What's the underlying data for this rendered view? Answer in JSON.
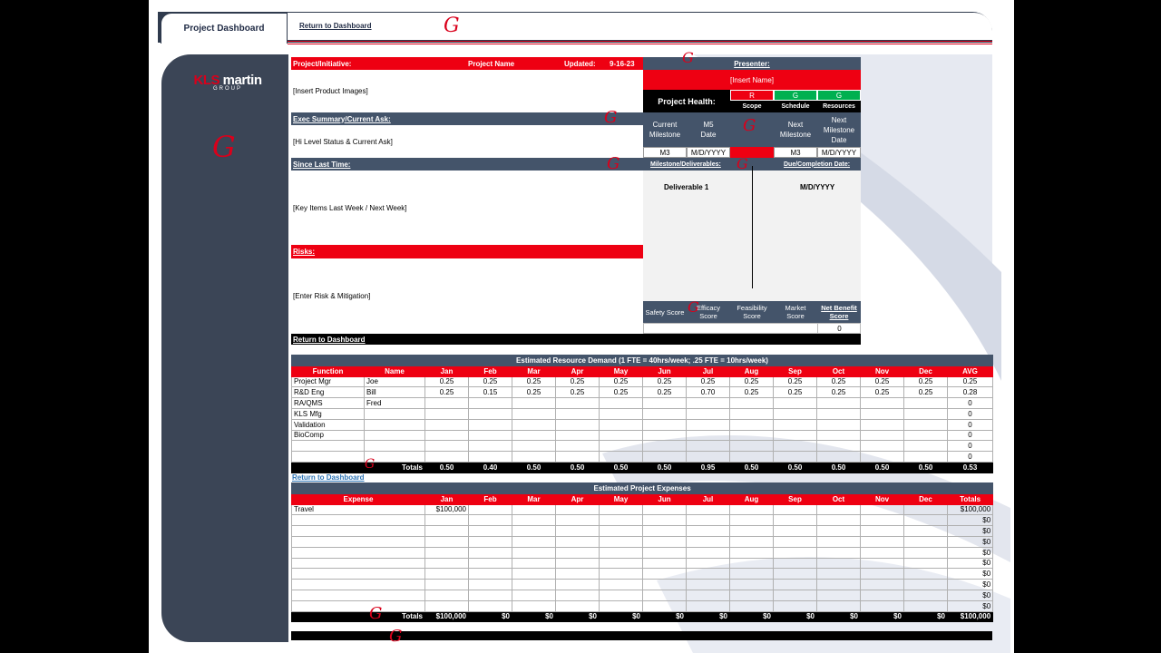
{
  "header": {
    "active_tab": "Project Dashboard",
    "return_link": "Return to Dashboard"
  },
  "logo": {
    "brand_a": "KLS",
    "brand_b": "martin",
    "group": "GROUP"
  },
  "project": {
    "label": "Project/Initiative:",
    "name": "Project Name",
    "updated_label": "Updated:",
    "updated_value": "9-16-23",
    "images_placeholder": "[Insert Product Images]",
    "exec_label": "Exec Summary/Current Ask:",
    "exec_value": "[Hi Level Status & Current Ask]",
    "since_label": "Since Last Time:",
    "since_value": "[Key Items Last Week / Next Week]",
    "risks_label": "Risks:",
    "risks_value": "[Enter Risk & Mitigation]",
    "return_link": "Return to Dashboard"
  },
  "presenter": {
    "label": "Presenter:",
    "name_placeholder": "[Insert Name]",
    "health_label": "Project Health:",
    "health": [
      {
        "value": "R",
        "label": "Scope",
        "color": "#ee0012"
      },
      {
        "value": "G",
        "label": "Schedule",
        "color": "#00b050"
      },
      {
        "value": "G",
        "label": "Resources",
        "color": "#00b050"
      }
    ],
    "milestones": {
      "current_label": "Current Milestone",
      "date_label": "M5 Date",
      "next_label": "Next Milestone",
      "next_date_label": "Next Milestone Date",
      "current_value": "M3",
      "current_date": "M/D/YYYY",
      "next_value": "M3",
      "next_date": "M/D/YYYY"
    },
    "deliverables_label": "Milestone/Deliverables:",
    "due_label": "Due/Completion Date:",
    "deliverable": "Deliverable 1",
    "deliverable_date": "M/D/YYYY",
    "scores": {
      "safety": "Safety Score",
      "efficacy": "Efficacy Score",
      "feasibility": "Feasibility Score",
      "market": "Market Score",
      "net_benefit": "Net Benefit Score",
      "net_benefit_value": "0"
    }
  },
  "resource_demand": {
    "title": "Estimated Resource Demand (1 FTE = 40hrs/week; .25 FTE = 10hrs/week)",
    "headers": [
      "Function",
      "Name",
      "Jan",
      "Feb",
      "Mar",
      "Apr",
      "May",
      "Jun",
      "Jul",
      "Aug",
      "Sep",
      "Oct",
      "Nov",
      "Dec",
      "AVG"
    ],
    "rows": [
      [
        "Project Mgr",
        "Joe",
        "0.25",
        "0.25",
        "0.25",
        "0.25",
        "0.25",
        "0.25",
        "0.25",
        "0.25",
        "0.25",
        "0.25",
        "0.25",
        "0.25",
        "0.25"
      ],
      [
        "R&D Eng",
        "Bill",
        "0.25",
        "0.15",
        "0.25",
        "0.25",
        "0.25",
        "0.25",
        "0.70",
        "0.25",
        "0.25",
        "0.25",
        "0.25",
        "0.25",
        "0.28"
      ],
      [
        "RA/QMS",
        "Fred",
        "",
        "",
        "",
        "",
        "",
        "",
        "",
        "",
        "",
        "",
        "",
        "",
        "0"
      ],
      [
        "KLS Mfg",
        "",
        "",
        "",
        "",
        "",
        "",
        "",
        "",
        "",
        "",
        "",
        "",
        "",
        "0"
      ],
      [
        "Validation",
        "",
        "",
        "",
        "",
        "",
        "",
        "",
        "",
        "",
        "",
        "",
        "",
        "",
        "0"
      ],
      [
        "BioComp",
        "",
        "",
        "",
        "",
        "",
        "",
        "",
        "",
        "",
        "",
        "",
        "",
        "",
        "0"
      ],
      [
        "",
        "",
        "",
        "",
        "",
        "",
        "",
        "",
        "",
        "",
        "",
        "",
        "",
        "",
        "0"
      ],
      [
        "",
        "",
        "",
        "",
        "",
        "",
        "",
        "",
        "",
        "",
        "",
        "",
        "",
        "",
        "0"
      ]
    ],
    "totals": [
      "",
      "Totals",
      "0.50",
      "0.40",
      "0.50",
      "0.50",
      "0.50",
      "0.50",
      "0.95",
      "0.50",
      "0.50",
      "0.50",
      "0.50",
      "0.50",
      "0.53"
    ]
  },
  "return_link_2": "Return to Dashboard",
  "expenses": {
    "title": "Estimated Project Expenses",
    "headers": [
      "Expense",
      "Jan",
      "Feb",
      "Mar",
      "Apr",
      "May",
      "Jun",
      "Jul",
      "Aug",
      "Sep",
      "Oct",
      "Nov",
      "Dec",
      "Totals"
    ],
    "rows": [
      [
        "Travel",
        "$100,000",
        "",
        "",
        "",
        "",
        "",
        "",
        "",
        "",
        "",
        "",
        "",
        "$100,000"
      ],
      [
        "",
        "",
        "",
        "",
        "",
        "",
        "",
        "",
        "",
        "",
        "",
        "",
        "",
        "$0"
      ],
      [
        "",
        "",
        "",
        "",
        "",
        "",
        "",
        "",
        "",
        "",
        "",
        "",
        "",
        "$0"
      ],
      [
        "",
        "",
        "",
        "",
        "",
        "",
        "",
        "",
        "",
        "",
        "",
        "",
        "",
        "$0"
      ],
      [
        "",
        "",
        "",
        "",
        "",
        "",
        "",
        "",
        "",
        "",
        "",
        "",
        "",
        "$0"
      ],
      [
        "",
        "",
        "",
        "",
        "",
        "",
        "",
        "",
        "",
        "",
        "",
        "",
        "",
        "$0"
      ],
      [
        "",
        "",
        "",
        "",
        "",
        "",
        "",
        "",
        "",
        "",
        "",
        "",
        "",
        "$0"
      ],
      [
        "",
        "",
        "",
        "",
        "",
        "",
        "",
        "",
        "",
        "",
        "",
        "",
        "",
        "$0"
      ],
      [
        "",
        "",
        "",
        "",
        "",
        "",
        "",
        "",
        "",
        "",
        "",
        "",
        "",
        "$0"
      ],
      [
        "",
        "",
        "",
        "",
        "",
        "",
        "",
        "",
        "",
        "",
        "",
        "",
        "",
        "$0"
      ]
    ],
    "totals": [
      "Totals",
      "$100,000",
      "$0",
      "$0",
      "$0",
      "$0",
      "$0",
      "$0",
      "$0",
      "$0",
      "$0",
      "$0",
      "$0",
      "$100,000"
    ]
  }
}
